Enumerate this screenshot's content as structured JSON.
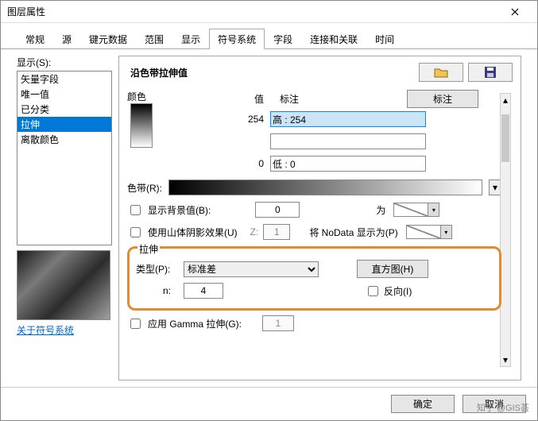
{
  "window": {
    "title": "图层属性"
  },
  "tabs": [
    "常规",
    "源",
    "键元数据",
    "范围",
    "显示",
    "符号系统",
    "字段",
    "连接和关联",
    "时间"
  ],
  "active_tab": 5,
  "left": {
    "show_label": "显示(S):",
    "items": [
      "矢量字段",
      "唯一值",
      "已分类",
      "拉伸",
      "离散颜色"
    ],
    "selected": 3,
    "about_link": "关于符号系统"
  },
  "right": {
    "title": "沿色带拉伸值",
    "color_label": "颜色",
    "value_label": "值",
    "anno_label": "标注",
    "anno_button": "标注",
    "max_value": "254",
    "max_text": "高 : 254",
    "min_value": "0",
    "min_text": "低 : 0",
    "ramp_label": "色带(R):",
    "show_bg_label": "显示背景值(B):",
    "bg_value": "0",
    "as_label": "为",
    "hillshade_label": "使用山体阴影效果(U)",
    "z_label": "Z:",
    "z_value": "1",
    "nodata_label": "将 NoData 显示为(P)",
    "stretch_group": "拉伸",
    "type_label": "类型(P):",
    "type_value": "标准差",
    "hist_button": "直方图(H)",
    "n_label": "n:",
    "n_value": "4",
    "invert_label": "反向(I)",
    "gamma_label": "应用 Gamma 拉伸(G):",
    "gamma_value": "1"
  },
  "footer": {
    "ok": "确定",
    "cancel": "取消"
  },
  "watermark": "知乎 @GIS荟"
}
